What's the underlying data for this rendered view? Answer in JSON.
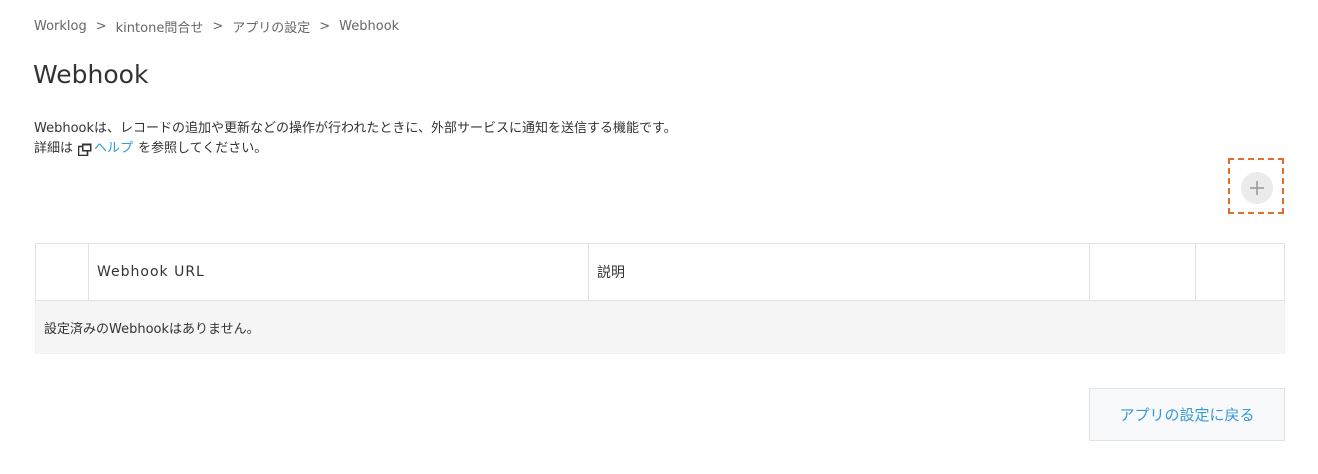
{
  "breadcrumb": {
    "items": [
      "Worklog",
      "kintone問合せ",
      "アプリの設定",
      "Webhook"
    ],
    "separator": ">"
  },
  "page": {
    "title": "Webhook",
    "description_line1": "Webhookは、レコードの追加や更新などの操作が行われたときに、外部サービスに通知を送信する機能です。",
    "description_prefix": "詳細は",
    "help_link": "ヘルプ",
    "description_suffix": "を参照してください。"
  },
  "toolbar": {
    "add_icon": "plus-icon",
    "help_icon": "external-window-icon"
  },
  "table": {
    "headers": [
      "",
      "Webhook URL",
      "説明",
      "",
      ""
    ],
    "empty_message": "設定済みのWebhookはありません。"
  },
  "footer": {
    "back_label": "アプリの設定に戻る"
  },
  "colors": {
    "link": "#3498db",
    "highlight": "#e06e2a",
    "table_border": "#e3e3e3",
    "empty_row_bg": "#f5f5f5",
    "add_button_bg": "#ebebeb"
  }
}
